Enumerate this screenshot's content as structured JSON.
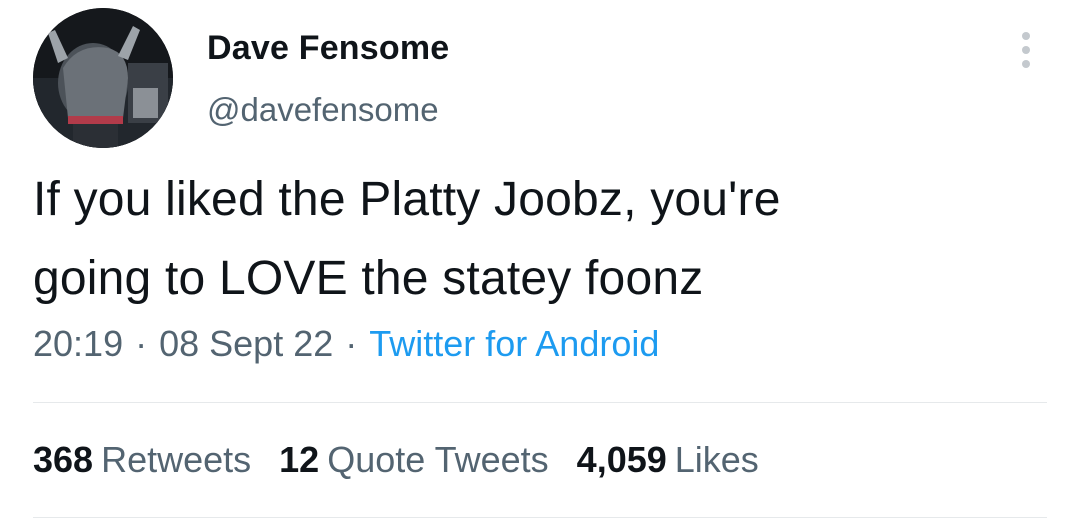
{
  "author": {
    "display_name": "Dave Fensome",
    "handle": "@davefensome"
  },
  "tweet": {
    "text_line_1": "If you liked the Platty Joobz, you're",
    "text_line_2": "going to LOVE the statey foonz",
    "time": "20:19",
    "date": "08 Sept 22",
    "separator": "·",
    "source": "Twitter for Android"
  },
  "stats": {
    "retweets_count": "368",
    "retweets_label": "Retweets",
    "quotes_count": "12",
    "quotes_label": "Quote Tweets",
    "likes_count": "4,059",
    "likes_label": "Likes"
  },
  "colors": {
    "text": "#0f1419",
    "secondary": "#536471",
    "link": "#1d9bf0",
    "divider": "#e6e9eb"
  },
  "icons": {
    "more": "more-vertical-icon"
  }
}
